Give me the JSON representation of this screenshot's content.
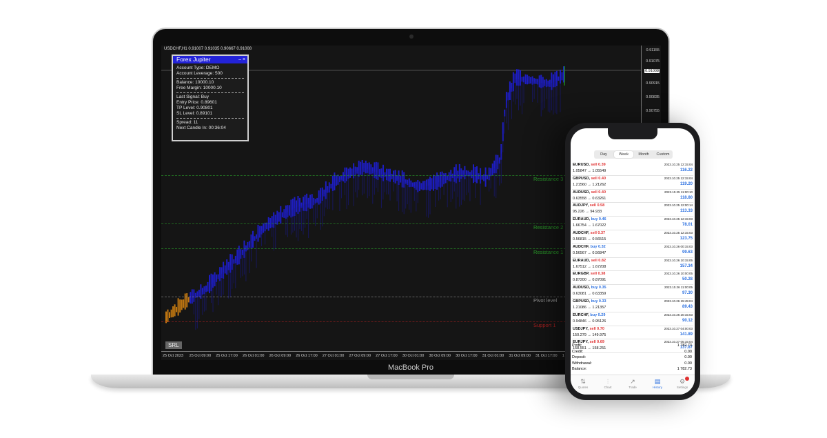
{
  "laptop": {
    "brand": "MacBook Pro",
    "chart": {
      "symbol_line": "USDCHF,H1  0.91007 0.91035 0.90667 0.91008",
      "price_labels": [
        {
          "text": "0.91155",
          "y": 0.91155
        },
        {
          "text": "0.91075",
          "y": 0.91075
        },
        {
          "text": "0.91008",
          "y": 0.91008,
          "current": true
        },
        {
          "text": "0.90915",
          "y": 0.90915
        },
        {
          "text": "0.90835",
          "y": 0.90835
        },
        {
          "text": "0.90755",
          "y": 0.90755
        }
      ],
      "time_labels": [
        "25 Oct 2023",
        "25 Oct 09:00",
        "25 Oct 17:00",
        "26 Oct 01:00",
        "26 Oct 09:00",
        "26 Oct 17:00",
        "27 Oct 01:00",
        "27 Oct 09:00",
        "27 Oct 17:00",
        "30 Oct 01:00",
        "30 Oct 09:00",
        "30 Oct 17:00",
        "31 Oct 01:00",
        "31 Oct 09:00",
        "31 Oct 17:00",
        "1 Nov 01:00",
        "1 Nov 09:00",
        "1 Nov 1"
      ],
      "levels": [
        {
          "label": "Resistance 3",
          "color": "#2aa02a"
        },
        {
          "label": "Resistance 2",
          "color": "#2aa02a"
        },
        {
          "label": "Resistance 1",
          "color": "#2aa02a"
        },
        {
          "label": "Pivot level",
          "color": "#9a9a9a"
        },
        {
          "label": "Support 1",
          "color": "#b02020"
        }
      ],
      "srl_label": "SRL",
      "colors": {
        "bull_candle": "#1f1fe0",
        "early_candle": "#e08a10",
        "background": "#151515"
      },
      "series_points": [
        [
          0.0,
          0.92
        ],
        [
          0.05,
          0.85
        ],
        [
          0.08,
          0.82
        ],
        [
          0.12,
          0.75
        ],
        [
          0.15,
          0.7
        ],
        [
          0.2,
          0.6
        ],
        [
          0.24,
          0.55
        ],
        [
          0.27,
          0.52
        ],
        [
          0.31,
          0.5
        ],
        [
          0.35,
          0.43
        ],
        [
          0.38,
          0.4
        ],
        [
          0.41,
          0.38
        ],
        [
          0.44,
          0.4
        ],
        [
          0.48,
          0.42
        ],
        [
          0.52,
          0.45
        ],
        [
          0.55,
          0.44
        ],
        [
          0.59,
          0.41
        ],
        [
          0.62,
          0.4
        ],
        [
          0.66,
          0.42
        ],
        [
          0.69,
          0.35
        ],
        [
          0.7,
          0.15
        ],
        [
          0.72,
          0.06
        ],
        [
          0.76,
          0.07
        ],
        [
          0.79,
          0.08
        ],
        [
          0.82,
          0.05
        ]
      ]
    },
    "panel": {
      "title": "Forex Jupiter",
      "controls": "–   ×",
      "account_type": "Account Type: DEMO",
      "account_leverage": "Account Leverage: 500",
      "balance": "Balance: 10000.10",
      "free_margin": "Free Margin: 10000.10",
      "last_signal": "Last Signal: Buy",
      "entry_price": "Entry Price: 0.89601",
      "tp_level": "TP Level: 0.90801",
      "sl_level": "SL Level: 0.89101",
      "spread": "Spread: 11",
      "next_candle": "Next Candle In: 00:36:04"
    }
  },
  "phone": {
    "segments": [
      {
        "label": "Day",
        "active": false
      },
      {
        "label": "Week",
        "active": true
      },
      {
        "label": "Month",
        "active": false
      },
      {
        "label": "Custom",
        "active": false
      }
    ],
    "trades": [
      {
        "symbol": "EURUSD,",
        "action": "sell 0.39",
        "side": "sell",
        "prices": "1.05847 → 1.05549",
        "date": "2023.10.25 12:15:04",
        "profit": "116.22"
      },
      {
        "symbol": "GBPUSD,",
        "action": "sell 0.40",
        "side": "sell",
        "prices": "1.21560 → 1.21262",
        "date": "2023.10.25 12:15:04",
        "profit": "119.20"
      },
      {
        "symbol": "AUDUSD,",
        "action": "sell 0.40",
        "side": "sell",
        "prices": "0.63558 → 0.63261",
        "date": "2023.10.25 11:00:10",
        "profit": "118.80"
      },
      {
        "symbol": "AUDJPY,",
        "action": "sell 0.58",
        "side": "sell",
        "prices": "95.226 → 94.933",
        "date": "2023.10.25 12:00:14",
        "profit": "113.33"
      },
      {
        "symbol": "EURAUD,",
        "action": "buy 0.46",
        "side": "buy",
        "prices": "1.66754 → 1.67022",
        "date": "2023.10.25 12:15:03",
        "profit": "78.01"
      },
      {
        "symbol": "AUDCHF,",
        "action": "sell 0.37",
        "side": "sell",
        "prices": "0.56815 → 0.56515",
        "date": "2023.10.25 12:15:03",
        "profit": "123.75"
      },
      {
        "symbol": "AUDCHF,",
        "action": "buy 0.32",
        "side": "buy",
        "prices": "0.56567 → 0.56847",
        "date": "2023.10.26 00:15:03",
        "profit": "99.63"
      },
      {
        "symbol": "EURAUD,",
        "action": "sell 0.82",
        "side": "sell",
        "prices": "1.67512 → 1.67208",
        "date": "2023.10.26 10:15:05",
        "profit": "157.34"
      },
      {
        "symbol": "EURGBP,",
        "action": "sell 0.38",
        "side": "sell",
        "prices": "0.87200 → 0.87091",
        "date": "2023.10.26 10:00:05",
        "profit": "50.28"
      },
      {
        "symbol": "AUDUSD,",
        "action": "buy 0.35",
        "side": "buy",
        "prices": "0.63081 → 0.63359",
        "date": "2023.10.26 11:00:05",
        "profit": "97.30"
      },
      {
        "symbol": "GBPUSD,",
        "action": "buy 0.33",
        "side": "buy",
        "prices": "1.21086 → 1.21357",
        "date": "2023.10.26 15:45:04",
        "profit": "89.43"
      },
      {
        "symbol": "EURCHF,",
        "action": "buy 0.29",
        "side": "buy",
        "prices": "0.94846 → 0.95126",
        "date": "2023.10.26 20:15:03",
        "profit": "90.12"
      },
      {
        "symbol": "USDJPY,",
        "action": "sell 0.70",
        "side": "sell",
        "prices": "150.279 → 149.975",
        "date": "2023.10.27 04:00:03",
        "profit": "141.89"
      },
      {
        "symbol": "EURJPY,",
        "action": "sell 0.69",
        "side": "sell",
        "prices": "158.551 → 158.251",
        "date": "2023.10.27 05:15:04",
        "profit": "137.87"
      }
    ],
    "summary": [
      {
        "label": "Profit:",
        "value": "1 782.73"
      },
      {
        "label": "Credit:",
        "value": "0.00"
      },
      {
        "label": "Deposit:",
        "value": "0.00"
      },
      {
        "label": "Withdrawal:",
        "value": "0.00"
      },
      {
        "label": "Balance:",
        "value": "1 782.73"
      }
    ],
    "tabs": [
      {
        "label": "Quotes",
        "icon": "quotes-icon",
        "glyph": "⇅",
        "active": false
      },
      {
        "label": "Chart",
        "icon": "chart-icon",
        "glyph": "⫶",
        "active": false
      },
      {
        "label": "Trade",
        "icon": "trade-icon",
        "glyph": "↗",
        "active": false
      },
      {
        "label": "History",
        "icon": "history-icon",
        "glyph": "▤",
        "active": true
      },
      {
        "label": "Settings",
        "icon": "settings-icon",
        "glyph": "⚙",
        "active": false
      }
    ],
    "colors": {
      "sell": "#e03030",
      "buy": "#2a6fe0",
      "profit": "#2a6fe0"
    }
  }
}
